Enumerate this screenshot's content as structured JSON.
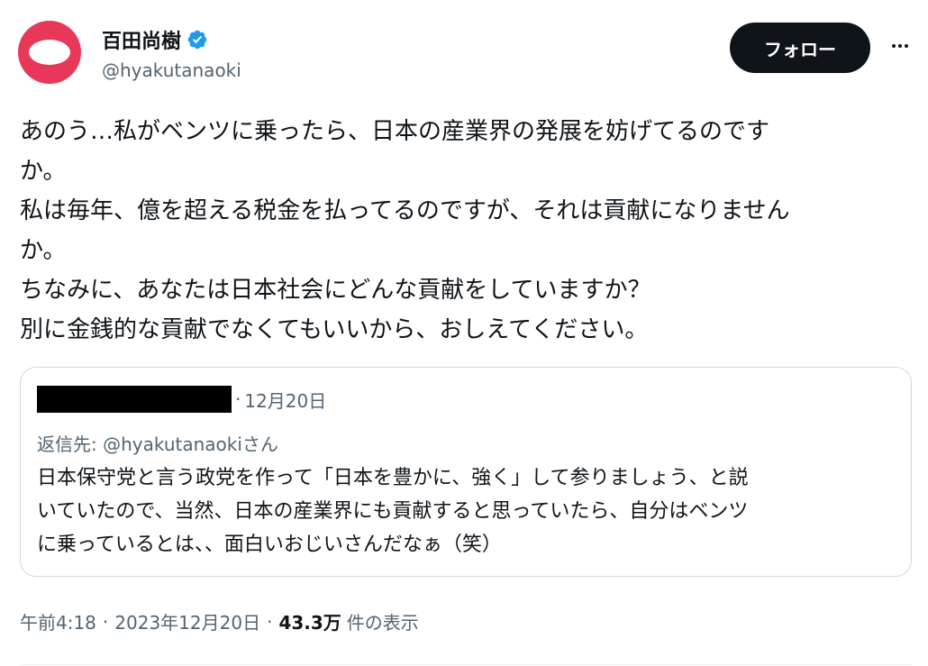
{
  "author": {
    "display_name": "百田尚樹",
    "handle": "@hyakutanaoki",
    "verified": true
  },
  "follow_button": {
    "label": "フォロー"
  },
  "more_button": {
    "icon": "more-horizontal-icon"
  },
  "tweet": {
    "lines": [
      "あのう…私がベンツに乗ったら、日本の産業界の発展を妨げてるのです",
      "か。",
      "私は毎年、億を超える税金を払ってるのですが、それは貢献になりません",
      "か。",
      "ちなみに、あなたは日本社会にどんな貢献をしていますか？",
      "別に金銭的な貢献でなくてもいいから、おしえてください。"
    ]
  },
  "quote": {
    "separator": "·",
    "date": "12月20日",
    "reply_to": "返信先: @hyakutanaokiさん",
    "lines": [
      "日本保守党と言う政党を作って「日本を豊かに、強く」して参りましょう、と説",
      "いていたので、当然、日本の産業界にも貢献すると思っていたら、自分はベンツ",
      "に乗っているとは、、面白いおじいさんだなぁ（笑）"
    ]
  },
  "meta": {
    "time": "午前4:18",
    "separator": "·",
    "date": "2023年12月20日",
    "views_count": "43.3万",
    "views_label": "件の表示"
  },
  "colors": {
    "text": "#0f1419",
    "secondary": "#536471",
    "avatar": "#e8385a",
    "verified": "#1d9bf0",
    "border": "#cfd9de"
  }
}
